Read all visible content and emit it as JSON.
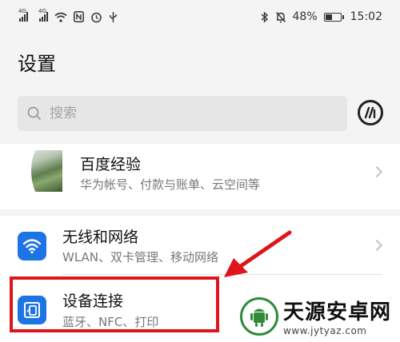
{
  "status_bar": {
    "signal1_label": "4G",
    "signal2_label": "4G",
    "battery": "48%",
    "battery_level": 0.48,
    "time": "15:02"
  },
  "page": {
    "title": "设置"
  },
  "search": {
    "placeholder": "搜索"
  },
  "account": {
    "name": "百度经验",
    "description": "华为帐号、付款与账单、云空间等"
  },
  "settings_items": [
    {
      "title": "无线和网络",
      "subtitle": "WLAN、双卡管理、移动网络",
      "icon": "wifi-icon"
    },
    {
      "title": "设备连接",
      "subtitle": "蓝牙、NFC、打印",
      "icon": "device-connection-icon"
    }
  ],
  "annotation": {
    "color": "#e0141b"
  },
  "watermark": {
    "name": "天源安卓网",
    "url": "www.jytyaz.com"
  },
  "colors": {
    "accent": "#1d74e5",
    "background": "#f4f4f4"
  }
}
